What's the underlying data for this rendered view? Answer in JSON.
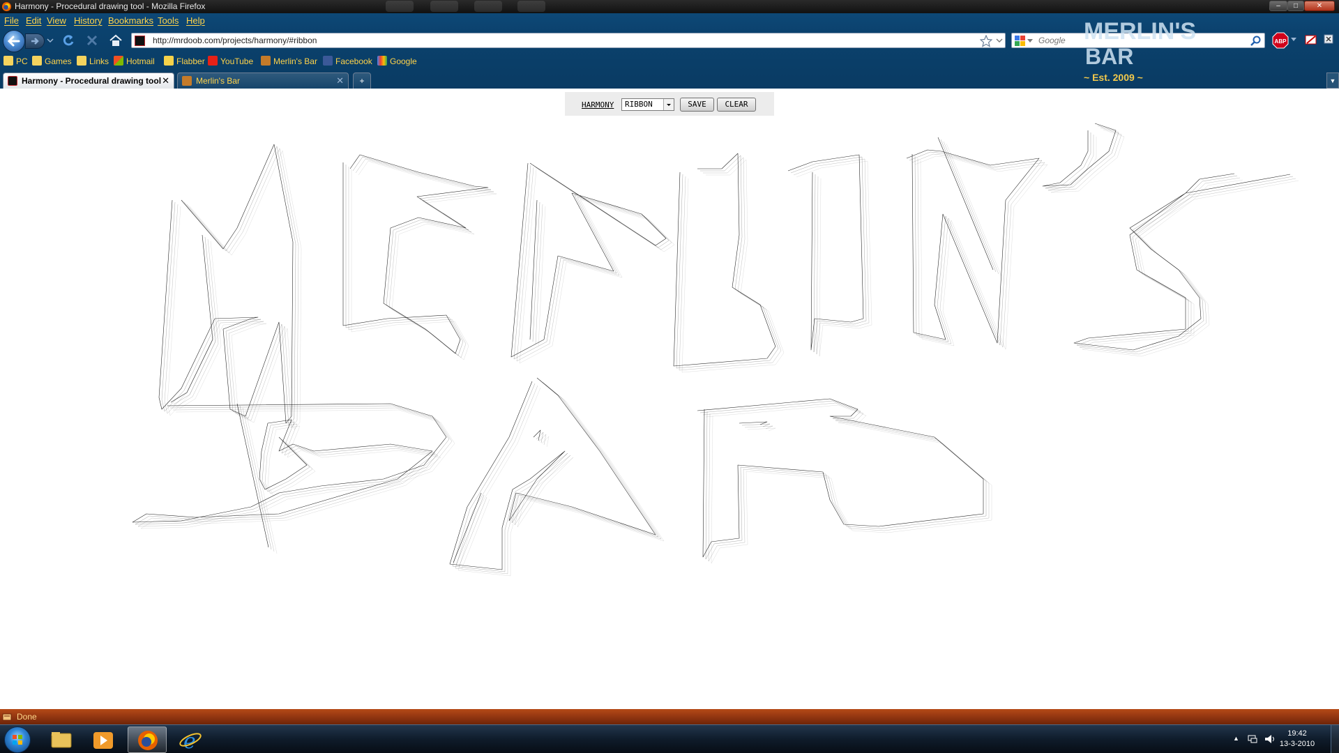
{
  "window": {
    "title": "Harmony - Procedural drawing tool - Mozilla Firefox",
    "controls": [
      "–",
      "□",
      "✕"
    ]
  },
  "menu": [
    "File",
    "Edit",
    "View",
    "History",
    "Bookmarks",
    "Tools",
    "Help"
  ],
  "navigation": {
    "url": "http://mrdoob.com/projects/harmony/#ribbon",
    "search_placeholder": "Google"
  },
  "bookmarks": [
    {
      "label": "PC",
      "icon": "folder-icon"
    },
    {
      "label": "Games",
      "icon": "folder-icon"
    },
    {
      "label": "Links",
      "icon": "folder-icon"
    },
    {
      "label": "Hotmail",
      "icon": "hotmail-icon"
    },
    {
      "label": "Flabber",
      "icon": "flabber-icon"
    },
    {
      "label": "YouTube",
      "icon": "youtube-icon"
    },
    {
      "label": "Merlin's Bar",
      "icon": "merlins-bar-icon"
    },
    {
      "label": "Facebook",
      "icon": "facebook-icon"
    },
    {
      "label": "Google",
      "icon": "google-icon"
    }
  ],
  "tabs": [
    {
      "label": "Harmony - Procedural drawing tool",
      "active": true
    },
    {
      "label": "Merlin's Bar",
      "active": false
    }
  ],
  "new_tab": "+",
  "persona": {
    "line1": "MERLIN'S",
    "line2": "BAR",
    "line3": "~ Est. 2009 ~"
  },
  "harmony": {
    "label": "HARMONY",
    "brush": "RIBBON",
    "save": "SAVE",
    "clear": "CLEAR"
  },
  "drawing": {
    "line1": "MERLIN'S",
    "line2": "BAR",
    "stroke_color": "#000000"
  },
  "status": {
    "text": "Done"
  },
  "taskbar": {
    "apps": [
      "explorer-icon",
      "media-player-icon",
      "firefox-icon",
      "internet-explorer-icon"
    ],
    "active_app": "firefox-icon",
    "time": "19:42",
    "date": "13-3-2010"
  },
  "colors": {
    "chrome_blue": "#0b426e",
    "menu_text": "#ffd34a",
    "status_orange": "#8f3410",
    "persona_text": "#cfe3f2"
  }
}
